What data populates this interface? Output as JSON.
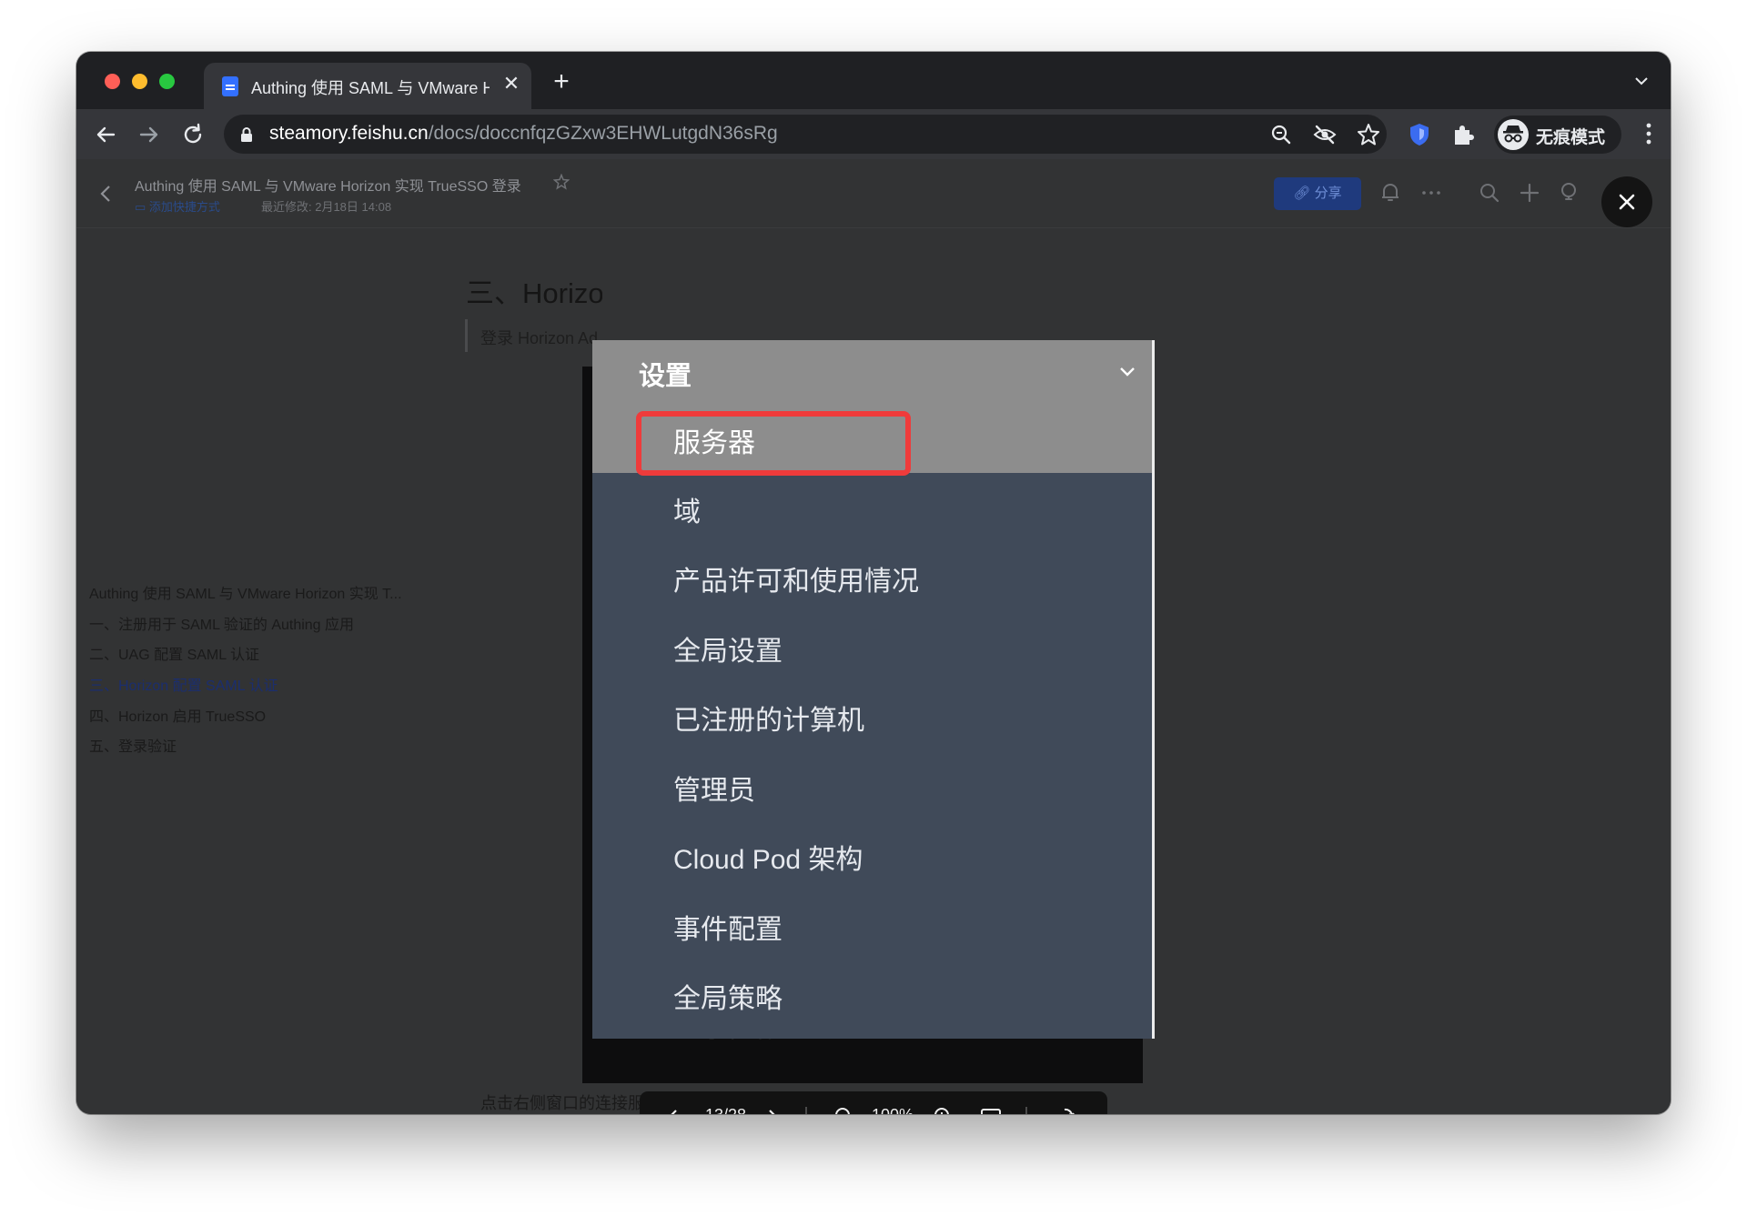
{
  "browser": {
    "tab": {
      "title": "Authing 使用 SAML 与 VMware Horizon 实现 TrueSSO 登录",
      "close_glyph": "✕",
      "new_tab_glyph": "+"
    },
    "address": {
      "host": "steamory.feishu.cn",
      "path": "/docs/doccnfqzGZxw3EHWLutgdN36sRg"
    },
    "profile_label": "无痕模式"
  },
  "doc": {
    "title": "Authing 使用 SAML 与 VMware Horizon 实现 TrueSSO 登录",
    "add_shortcut": "添加快捷方式",
    "last_modified": "最近修改: 2月18日 14:08",
    "share_label": "分享",
    "heading": "三、Horizon 配置 SAML 认证",
    "quote": "登录 Horizon Administrator",
    "caption": "点击右侧窗口的连接服务器，选中要配置 TrueSSO 的连接服务器点击编辑按钮。",
    "background_item": "全局策略"
  },
  "outline": [
    {
      "label": "Authing 使用 SAML 与 VMware Horizon 实现 T...",
      "active": false
    },
    {
      "label": "一、注册用于 SAML 验证的 Authing 应用",
      "active": false
    },
    {
      "label": "二、UAG 配置 SAML 认证",
      "active": false
    },
    {
      "label": "三、Horizon 配置 SAML 认证",
      "active": true
    },
    {
      "label": "四、Horizon 启用 TrueSSO",
      "active": false
    },
    {
      "label": "五、登录验证",
      "active": false
    }
  ],
  "settings_panel": {
    "title": "设置",
    "items": [
      {
        "label": "服务器",
        "selected": true
      },
      {
        "label": "域",
        "selected": false
      },
      {
        "label": "产品许可和使用情况",
        "selected": false
      },
      {
        "label": "全局设置",
        "selected": false
      },
      {
        "label": "已注册的计算机",
        "selected": false
      },
      {
        "label": "管理员",
        "selected": false
      },
      {
        "label": "Cloud Pod 架构",
        "selected": false
      },
      {
        "label": "事件配置",
        "selected": false
      },
      {
        "label": "全局策略",
        "selected": false
      }
    ]
  },
  "viewer": {
    "page_indicator": "13/28",
    "zoom": "100%"
  },
  "icons": {
    "back": "arrow-left-icon",
    "forward": "arrow-right-icon",
    "reload": "reload-icon",
    "lock": "lock-icon",
    "zoom": "magnifier-icon",
    "eye_off": "eye-off-icon",
    "star": "star-icon",
    "shield": "shield-icon",
    "puzzle": "puzzle-icon",
    "incognito": "incognito-icon"
  },
  "colors": {
    "highlight": "#ef3b3b",
    "panel": "#404a59",
    "panel_header": "#8d8d8d",
    "accent": "#3370ff"
  }
}
